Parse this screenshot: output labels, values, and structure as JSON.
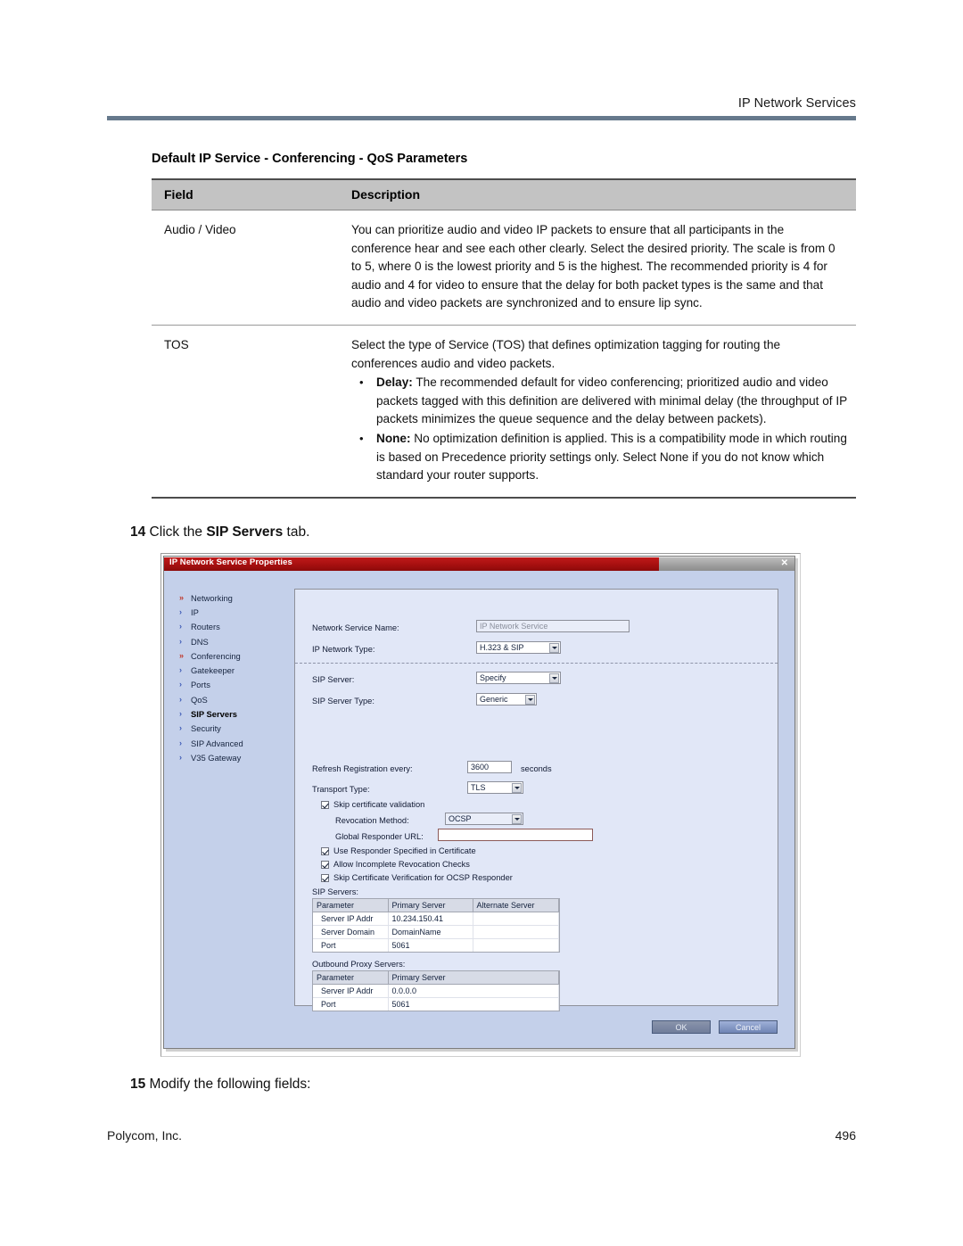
{
  "header": {
    "title": "IP Network Services"
  },
  "doc_table": {
    "caption": "Default IP Service - Conferencing - QoS Parameters",
    "columns": {
      "field": "Field",
      "description": "Description"
    },
    "rows": [
      {
        "field": "Audio / Video",
        "description": "You can prioritize audio and video IP packets to ensure that all participants in the conference hear and see each other clearly. Select the desired priority. The scale is from 0 to 5, where 0 is the lowest priority and 5 is the highest. The recommended priority is 4 for audio and 4 for video to ensure that the delay for both packet types is the same and that audio and video packets are synchronized and to ensure lip sync."
      },
      {
        "field": "TOS",
        "description": "Select the type of Service (TOS) that defines optimization tagging for routing the conferences audio and video packets.",
        "bullets": [
          {
            "term": "Delay",
            "sep": ":",
            "text": " The recommended default for video conferencing; prioritized audio and video packets tagged with this definition are delivered with minimal delay (the throughput of IP packets minimizes the queue sequence and the delay between packets)."
          },
          {
            "term": "None",
            "sep": ":",
            "text": " No optimization definition is applied. This is a compatibility mode in which routing is based on Precedence priority settings only. Select None if you do not know which standard your router supports."
          }
        ]
      }
    ]
  },
  "steps": {
    "step14_num": "14",
    "step14_pre": " Click the ",
    "step14_bold": "SIP Servers",
    "step14_post": " tab.",
    "step15_num": "15",
    "step15_text": " Modify the following fields:"
  },
  "footer": {
    "company": "Polycom, Inc.",
    "page": "496"
  },
  "dialog": {
    "title": "IP Network Service Properties",
    "close_label": "✕",
    "nav": [
      {
        "label": "Networking",
        "icon": "double-chevron-icon",
        "glyph": "»",
        "hot": true,
        "selected": false
      },
      {
        "label": "IP",
        "icon": "chevron-right-icon",
        "glyph": "›",
        "hot": false,
        "selected": false
      },
      {
        "label": "Routers",
        "icon": "chevron-right-icon",
        "glyph": "›",
        "hot": false,
        "selected": false
      },
      {
        "label": "DNS",
        "icon": "chevron-right-icon",
        "glyph": "›",
        "hot": false,
        "selected": false
      },
      {
        "label": "Conferencing",
        "icon": "double-chevron-icon",
        "glyph": "»",
        "hot": true,
        "selected": false
      },
      {
        "label": "Gatekeeper",
        "icon": "chevron-right-icon",
        "glyph": "›",
        "hot": false,
        "selected": false
      },
      {
        "label": "Ports",
        "icon": "chevron-right-icon",
        "glyph": "›",
        "hot": false,
        "selected": false
      },
      {
        "label": "QoS",
        "icon": "chevron-right-icon",
        "glyph": "›",
        "hot": false,
        "selected": false
      },
      {
        "label": "SIP Servers",
        "icon": "chevron-right-icon",
        "glyph": "›",
        "hot": false,
        "selected": true
      },
      {
        "label": "Security",
        "icon": "chevron-right-icon",
        "glyph": "›",
        "hot": false,
        "selected": false
      },
      {
        "label": "SIP Advanced",
        "icon": "chevron-right-icon",
        "glyph": "›",
        "hot": false,
        "selected": false
      },
      {
        "label": "V35 Gateway",
        "icon": "chevron-right-icon",
        "glyph": "›",
        "hot": false,
        "selected": false
      }
    ],
    "fields": {
      "service_name_label": "Network Service Name:",
      "service_name_value": "IP Network Service",
      "network_type_label": "IP Network Type:",
      "network_type_value": "H.323 & SIP",
      "sip_server_label": "SIP Server:",
      "sip_server_value": "Specify",
      "sip_server_type_label": "SIP Server Type:",
      "sip_server_type_value": "Generic",
      "refresh_label": "Refresh Registration every:",
      "refresh_value": "3600",
      "refresh_units": "seconds",
      "transport_label": "Transport Type:",
      "transport_value": "TLS",
      "skip_cert_validation": "Skip certificate validation",
      "revocation_label": "Revocation Method:",
      "revocation_value": "OCSP",
      "responder_url_label": "Global Responder URL:",
      "responder_url_value": "",
      "use_responder": "Use Responder Specified in Certificate",
      "allow_incomplete": "Allow Incomplete Revocation Checks",
      "skip_ocsp_verify": "Skip Certificate Verification for OCSP Responder"
    },
    "sip_servers_grid": {
      "title": "SIP Servers:",
      "columns": [
        "Parameter",
        "Primary Server",
        "Alternate Server"
      ],
      "rows": [
        [
          "Server IP Addr",
          "10.234.150.41",
          ""
        ],
        [
          "Server Domain",
          "DomainName",
          ""
        ],
        [
          "Port",
          "5061",
          ""
        ]
      ]
    },
    "proxy_grid": {
      "title": "Outbound Proxy Servers:",
      "columns": [
        "Parameter",
        "Primary Server"
      ],
      "rows": [
        [
          "Server IP Addr",
          "0.0.0.0"
        ],
        [
          "Port",
          "5061"
        ]
      ]
    },
    "buttons": {
      "ok": "OK",
      "cancel": "Cancel"
    }
  }
}
